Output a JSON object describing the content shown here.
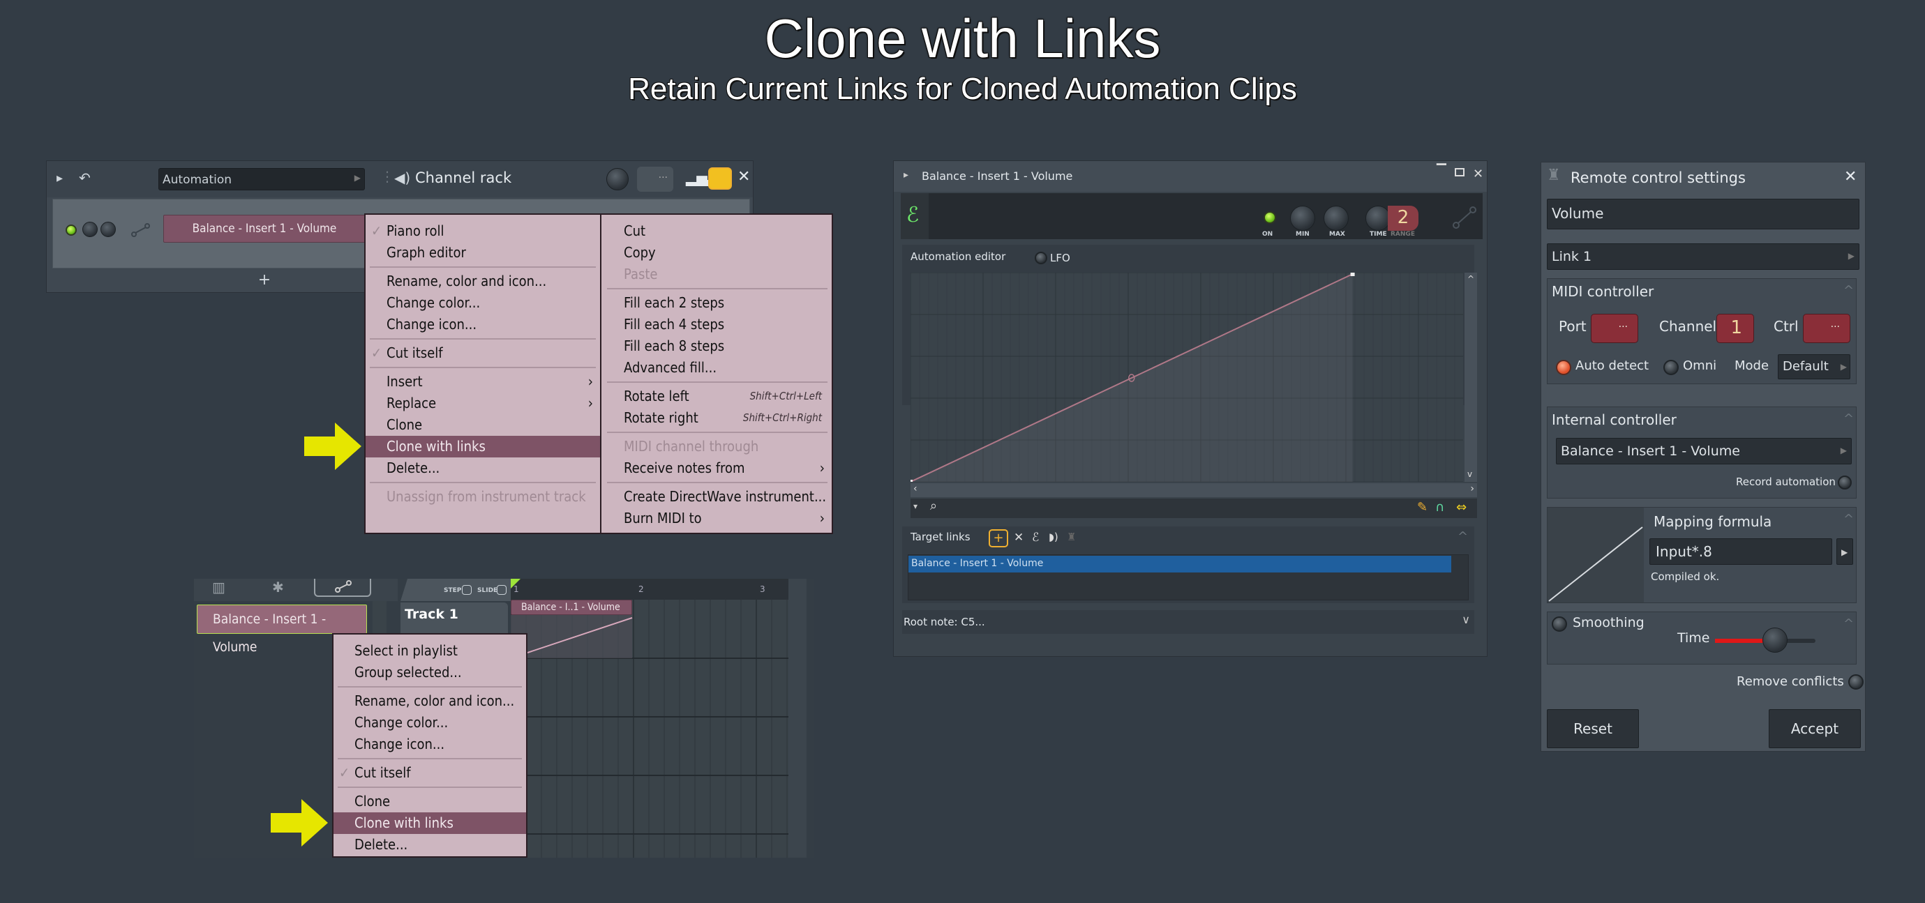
{
  "hero": {
    "title": "Clone with Links",
    "subtitle": "Retain Current Links for Cloned Automation Clips"
  },
  "channel_rack": {
    "filter_dropdown": "Automation",
    "title": "Channel rack",
    "swing_display": "···",
    "channel_name": "Balance - Insert 1 - Volume",
    "add_label": "+",
    "icons": [
      "play-arrow-icon",
      "undo-icon",
      "speaker-icon",
      "knob-icon",
      "graph-icon",
      "step-sequencer-icon",
      "close-icon"
    ]
  },
  "channel_menu": {
    "left": [
      {
        "label": "Piano roll",
        "checked": true
      },
      {
        "label": "Graph editor"
      },
      {
        "separator": true
      },
      {
        "label": "Rename, color and icon..."
      },
      {
        "label": "Change color..."
      },
      {
        "label": "Change icon..."
      },
      {
        "separator": true
      },
      {
        "label": "Cut itself",
        "checked": true
      },
      {
        "separator": true
      },
      {
        "label": "Insert",
        "submenu": true
      },
      {
        "label": "Replace",
        "submenu": true
      },
      {
        "label": "Clone"
      },
      {
        "label": "Clone with links",
        "highlighted": true
      },
      {
        "label": "Delete..."
      },
      {
        "separator": true
      },
      {
        "label": "Unassign from instrument track",
        "disabled": true
      }
    ],
    "right": [
      {
        "label": "Cut"
      },
      {
        "label": "Copy"
      },
      {
        "label": "Paste",
        "disabled": true
      },
      {
        "separator": true
      },
      {
        "label": "Fill each 2 steps"
      },
      {
        "label": "Fill each 4 steps"
      },
      {
        "label": "Fill each 8 steps"
      },
      {
        "label": "Advanced fill..."
      },
      {
        "separator": true
      },
      {
        "label": "Rotate left",
        "shortcut": "Shift+Ctrl+Left"
      },
      {
        "label": "Rotate right",
        "shortcut": "Shift+Ctrl+Right"
      },
      {
        "separator": true
      },
      {
        "label": "MIDI channel through",
        "disabled": true
      },
      {
        "label": "Receive notes from",
        "submenu": true
      },
      {
        "separator": true
      },
      {
        "label": "Create DirectWave instrument..."
      },
      {
        "label": "Burn MIDI to",
        "submenu": true
      }
    ]
  },
  "playlist": {
    "step_label": "STEP",
    "slide_label": "SLIDE",
    "picker_clip": "Balance - Insert 1 - Volume",
    "track_name": "Track 1",
    "clip_label": "Balance - I..1 - Volume",
    "bar_numbers": [
      "1",
      "2",
      "3"
    ]
  },
  "clip_menu": {
    "items": [
      {
        "label": "Select in playlist"
      },
      {
        "label": "Group selected..."
      },
      {
        "separator": true
      },
      {
        "label": "Rename, color and icon..."
      },
      {
        "label": "Change color..."
      },
      {
        "label": "Change icon..."
      },
      {
        "separator": true
      },
      {
        "label": "Cut itself",
        "checked": true
      },
      {
        "separator": true
      },
      {
        "label": "Clone"
      },
      {
        "label": "Clone with links",
        "highlighted": true
      },
      {
        "label": "Delete..."
      }
    ]
  },
  "automation_window": {
    "title": "Balance - Insert 1 - Volume",
    "on_label": "ON",
    "min_label": "MIN",
    "max_label": "MAX",
    "time_label": "TIME",
    "range_label": "RANGE",
    "range_value": "2",
    "editor_tab": "Automation editor",
    "lfo_label": "LFO",
    "envelope": {
      "points": [
        [
          0,
          0
        ],
        [
          1,
          1
        ]
      ],
      "tension_point": [
        0.5,
        0.5
      ],
      "end_fraction_of_view": 0.8
    },
    "target_links_label": "Target links",
    "target_links": [
      "Balance - Insert 1 - Volume"
    ],
    "root_note": "Root note: C5..."
  },
  "remote_control": {
    "title": "Remote control settings",
    "name_value": "Volume",
    "link_select": "Link 1",
    "midi_section": "MIDI controller",
    "port_label": "Port",
    "port_value": "···",
    "channel_label": "Channel",
    "channel_value": "1",
    "ctrl_label": "Ctrl",
    "ctrl_value": "···",
    "auto_detect_label": "Auto detect",
    "omni_label": "Omni",
    "mode_label": "Mode",
    "mode_value": "Default",
    "internal_section": "Internal controller",
    "internal_value": "Balance - Insert 1 - Volume",
    "record_label": "Record automation",
    "mapping_section": "Mapping formula",
    "formula_value": "Input*.8",
    "compile_status": "Compiled ok.",
    "smoothing_label": "Smoothing",
    "time_label": "Time",
    "smoothing_time": 0.5,
    "remove_conflicts_label": "Remove conflicts",
    "reset_label": "Reset",
    "accept_label": "Accept"
  },
  "colors": {
    "background": "#333c45",
    "menu_bg": "#cdb6c0",
    "highlight": "#7e5366",
    "arrow": "#e6e600",
    "selection_blue": "#1f5f9e",
    "led_green": "#8ee83a",
    "accent_orange": "#f0b030"
  }
}
